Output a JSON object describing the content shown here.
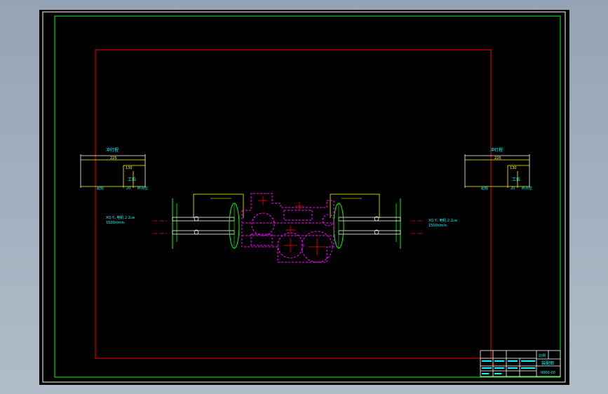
{
  "colors": {
    "frame_white": "#ffffff",
    "border_green": "#00ff00",
    "zone_red": "#ff0000",
    "dim_yellow": "#ffff00",
    "text_cyan": "#00ffff",
    "gear_magenta": "#ff00ff",
    "axle_white": "#ffffff"
  },
  "left_detail": {
    "stroke_label": "冲行程",
    "total_dim": "225",
    "sub_dim": "130",
    "station_label": "工位",
    "start_label": "起始",
    "mid_label": "20",
    "end_label": "终点位"
  },
  "right_detail": {
    "stroke_label": "冲行程",
    "total_dim": "225",
    "sub_dim": "130",
    "station_label": "工位",
    "start_label": "起始",
    "mid_label": "20",
    "end_label": "终点位"
  },
  "left_motor_note": {
    "line1": "XQ-Yₙ 电机 2.2ₖw",
    "line2": "1500r/min"
  },
  "right_motor_note": {
    "line1": "XQ-Yₙ 电机 2.2ₖw",
    "line2": "1500r/min"
  },
  "title_block": {
    "drawing_title": "装配图",
    "scale_label": "比例",
    "code": "0000-00"
  }
}
